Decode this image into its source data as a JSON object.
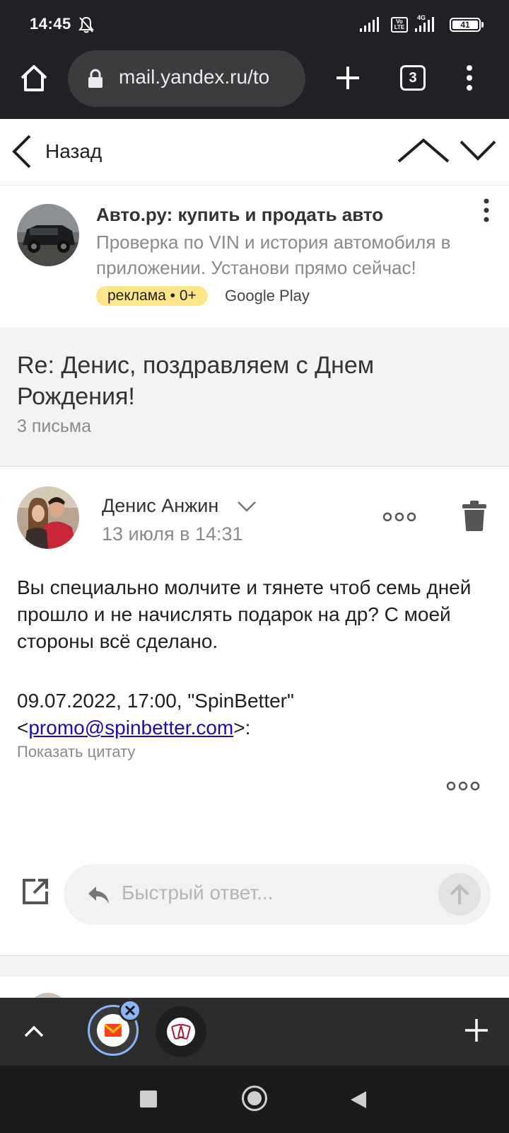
{
  "status_bar": {
    "time": "14:45",
    "network_label": "4G",
    "volte_label": "Vo LTE",
    "battery": "41"
  },
  "browser": {
    "url": "mail.yandex.ru/to",
    "tab_count": "3"
  },
  "mail_header": {
    "back_label": "Назад"
  },
  "ad": {
    "title": "Авто.ру: купить и продать авто",
    "text": "Проверка по VIN и история автомобиля в приложении. Установи прямо сейчас!",
    "badge": "реклама • 0+",
    "source": "Google Play"
  },
  "thread": {
    "subject": "Re: Денис, поздравляем с Днем Рождения!",
    "count": "3 письма"
  },
  "message": {
    "sender": "Денис Анжин",
    "date": "13 июля в 14:31",
    "body": "Вы специально молчите и тянете чтоб семь дней прошло и не начислять подарок на др? С моей стороны всё сделано.",
    "quote_prefix": "09.07.2022, 17:00, \"SpinBetter\" <",
    "quote_email": "promo@spinbetter.com",
    "quote_suffix": ">:",
    "show_quote": "Показать цитату",
    "reply_placeholder": "Быстрый ответ..."
  },
  "colors": {
    "browser_chrome": "#202124",
    "ad_badge": "#fde68a",
    "link": "#1a0dab",
    "thread_bg": "#f4f3f2",
    "tab_highlight": "#8ab4f8"
  }
}
